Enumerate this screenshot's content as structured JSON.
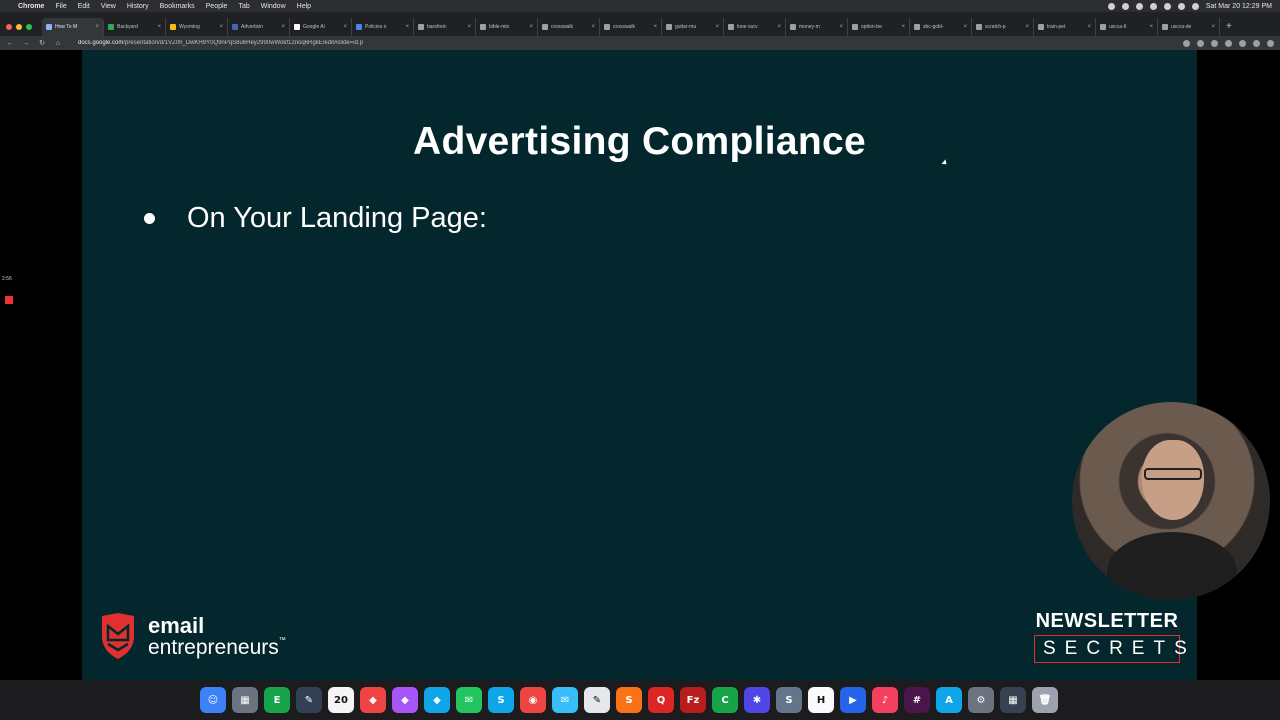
{
  "menubar": {
    "app": "Chrome",
    "items": [
      "File",
      "Edit",
      "View",
      "History",
      "Bookmarks",
      "People",
      "Tab",
      "Window",
      "Help"
    ],
    "clock": "Sat Mar 20  12:29 PM"
  },
  "tabs": [
    {
      "label": "How To M",
      "active": true,
      "color": "#8ab4f8"
    },
    {
      "label": "Backyard",
      "active": false,
      "color": "#34a853"
    },
    {
      "label": "Wyoming",
      "active": false,
      "color": "#fbbc05"
    },
    {
      "label": "Advertisin",
      "active": false,
      "color": "#4267b2"
    },
    {
      "label": "Google Ai",
      "active": false,
      "color": "#ffffff"
    },
    {
      "label": "Policies o",
      "active": false,
      "color": "#4285f4"
    },
    {
      "label": "barefoot-",
      "active": false,
      "color": "#9aa0a6"
    },
    {
      "label": "bible-min",
      "active": false,
      "color": "#9aa0a6"
    },
    {
      "label": "crosswalk",
      "active": false,
      "color": "#9aa0a6"
    },
    {
      "label": "crosswalk",
      "active": false,
      "color": "#9aa0a6"
    },
    {
      "label": "guitar-mu",
      "active": false,
      "color": "#9aa0a6"
    },
    {
      "label": "lone-surv",
      "active": false,
      "color": "#9aa0a6"
    },
    {
      "label": "money-m",
      "active": false,
      "color": "#9aa0a6"
    },
    {
      "label": "option-be",
      "active": false,
      "color": "#9aa0a6"
    },
    {
      "label": "sbc-gold-",
      "active": false,
      "color": "#9aa0a6"
    },
    {
      "label": "scratch-p",
      "active": false,
      "color": "#9aa0a6"
    },
    {
      "label": "train-pet",
      "active": false,
      "color": "#9aa0a6"
    },
    {
      "label": "uscca-6",
      "active": false,
      "color": "#9aa0a6"
    },
    {
      "label": "uscca-de",
      "active": false,
      "color": "#9aa0a6"
    }
  ],
  "address": {
    "host": "docs.google.com",
    "path": "/presentation/d/1VZ0h_DwKH9Y0Q9nPqS8u6Hey2990wWokf12noq6RgkE/edit#slide=id.p"
  },
  "slide": {
    "title": "Advertising Compliance",
    "bullet": "On Your Landing Page:",
    "background": "#03272c"
  },
  "branding": {
    "left_line1": "email",
    "left_line2": "entrepreneurs",
    "left_tm": "™",
    "right_top": "NEWSLETTER",
    "right_bottom": "SECRETS",
    "accent": "#e03030"
  },
  "recorder": {
    "time": "2:56"
  },
  "dock": [
    {
      "name": "finder",
      "glyph": "☺",
      "color": "#3b82f6"
    },
    {
      "name": "launchpad",
      "glyph": "▦",
      "color": "#6b7280"
    },
    {
      "name": "evernote",
      "glyph": "E",
      "color": "#16a34a"
    },
    {
      "name": "app",
      "glyph": "✎",
      "color": "#334155"
    },
    {
      "name": "calendar",
      "glyph": "20",
      "color": "#f5f5f5"
    },
    {
      "name": "affinity-publisher",
      "glyph": "◆",
      "color": "#ef4444"
    },
    {
      "name": "affinity-photo",
      "glyph": "◆",
      "color": "#a855f7"
    },
    {
      "name": "affinity-designer",
      "glyph": "◆",
      "color": "#0ea5e9"
    },
    {
      "name": "messages",
      "glyph": "✉",
      "color": "#22c55e"
    },
    {
      "name": "skype",
      "glyph": "S",
      "color": "#0ea5e9"
    },
    {
      "name": "chrome",
      "glyph": "◉",
      "color": "#ef4444"
    },
    {
      "name": "mail",
      "glyph": "✉",
      "color": "#38bdf8"
    },
    {
      "name": "textedit",
      "glyph": "✎",
      "color": "#e5e7eb"
    },
    {
      "name": "sublime",
      "glyph": "S",
      "color": "#f97316"
    },
    {
      "name": "quit",
      "glyph": "Q",
      "color": "#dc2626"
    },
    {
      "name": "filezilla",
      "glyph": "Fz",
      "color": "#b91c1c"
    },
    {
      "name": "camtasia",
      "glyph": "C",
      "color": "#16a34a"
    },
    {
      "name": "system-tool",
      "glyph": "✱",
      "color": "#4f46e5"
    },
    {
      "name": "app-s",
      "glyph": "S",
      "color": "#64748b"
    },
    {
      "name": "headlines",
      "glyph": "H",
      "color": "#f8fafc"
    },
    {
      "name": "zoom",
      "glyph": "▶",
      "color": "#2563eb"
    },
    {
      "name": "music",
      "glyph": "♪",
      "color": "#f43f5e"
    },
    {
      "name": "slack",
      "glyph": "#",
      "color": "#4a154b"
    },
    {
      "name": "app-store",
      "glyph": "A",
      "color": "#0ea5e9"
    },
    {
      "name": "system-preferences",
      "glyph": "⚙",
      "color": "#6b7280"
    },
    {
      "name": "calculator",
      "glyph": "▦",
      "color": "#374151"
    },
    {
      "name": "trash",
      "glyph": "🗑",
      "color": "#9ca3af"
    }
  ]
}
